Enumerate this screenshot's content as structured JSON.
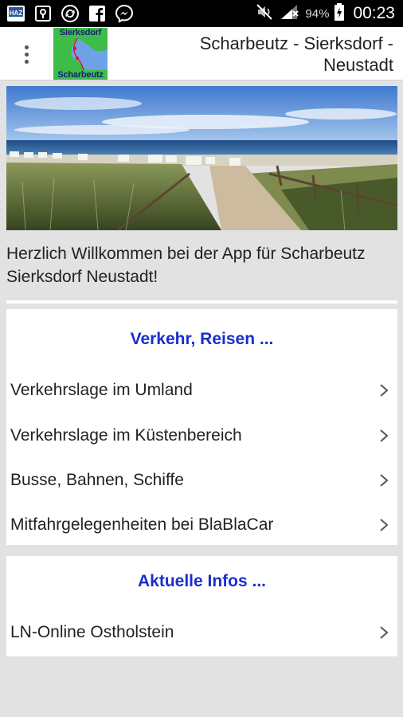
{
  "status_bar": {
    "icons_left": [
      "haz-app-icon",
      "vpn-key-icon",
      "sync-icon",
      "facebook-icon",
      "messenger-icon"
    ],
    "haz_label": "HAZ",
    "battery_percent": "94%",
    "time": "00:23"
  },
  "app_bar": {
    "logo_top": "Sierksdorf",
    "logo_bottom": "Scharbeutz",
    "title_line1": "Scharbeutz - Sierksdorf -",
    "title_line2": "Neustadt"
  },
  "welcome_text": "Herzlich Willkommen bei der App für Scharbeutz Sierksdorf Neustadt!",
  "sections": [
    {
      "title": "Verkehr, Reisen ...",
      "items": [
        {
          "label": "Verkehrslage im Umland"
        },
        {
          "label": "Verkehrslage im Küstenbereich"
        },
        {
          "label": "Busse, Bahnen, Schiffe"
        },
        {
          "label": "Mitfahrgelegenheiten bei BlaBlaCar"
        }
      ]
    },
    {
      "title": "Aktuelle Infos ...",
      "items": [
        {
          "label": "LN-Online Ostholstein"
        }
      ]
    }
  ],
  "colors": {
    "section_title": "#1a2fcc",
    "background": "#e2e2e2",
    "logo_bg": "#3dbd48"
  }
}
